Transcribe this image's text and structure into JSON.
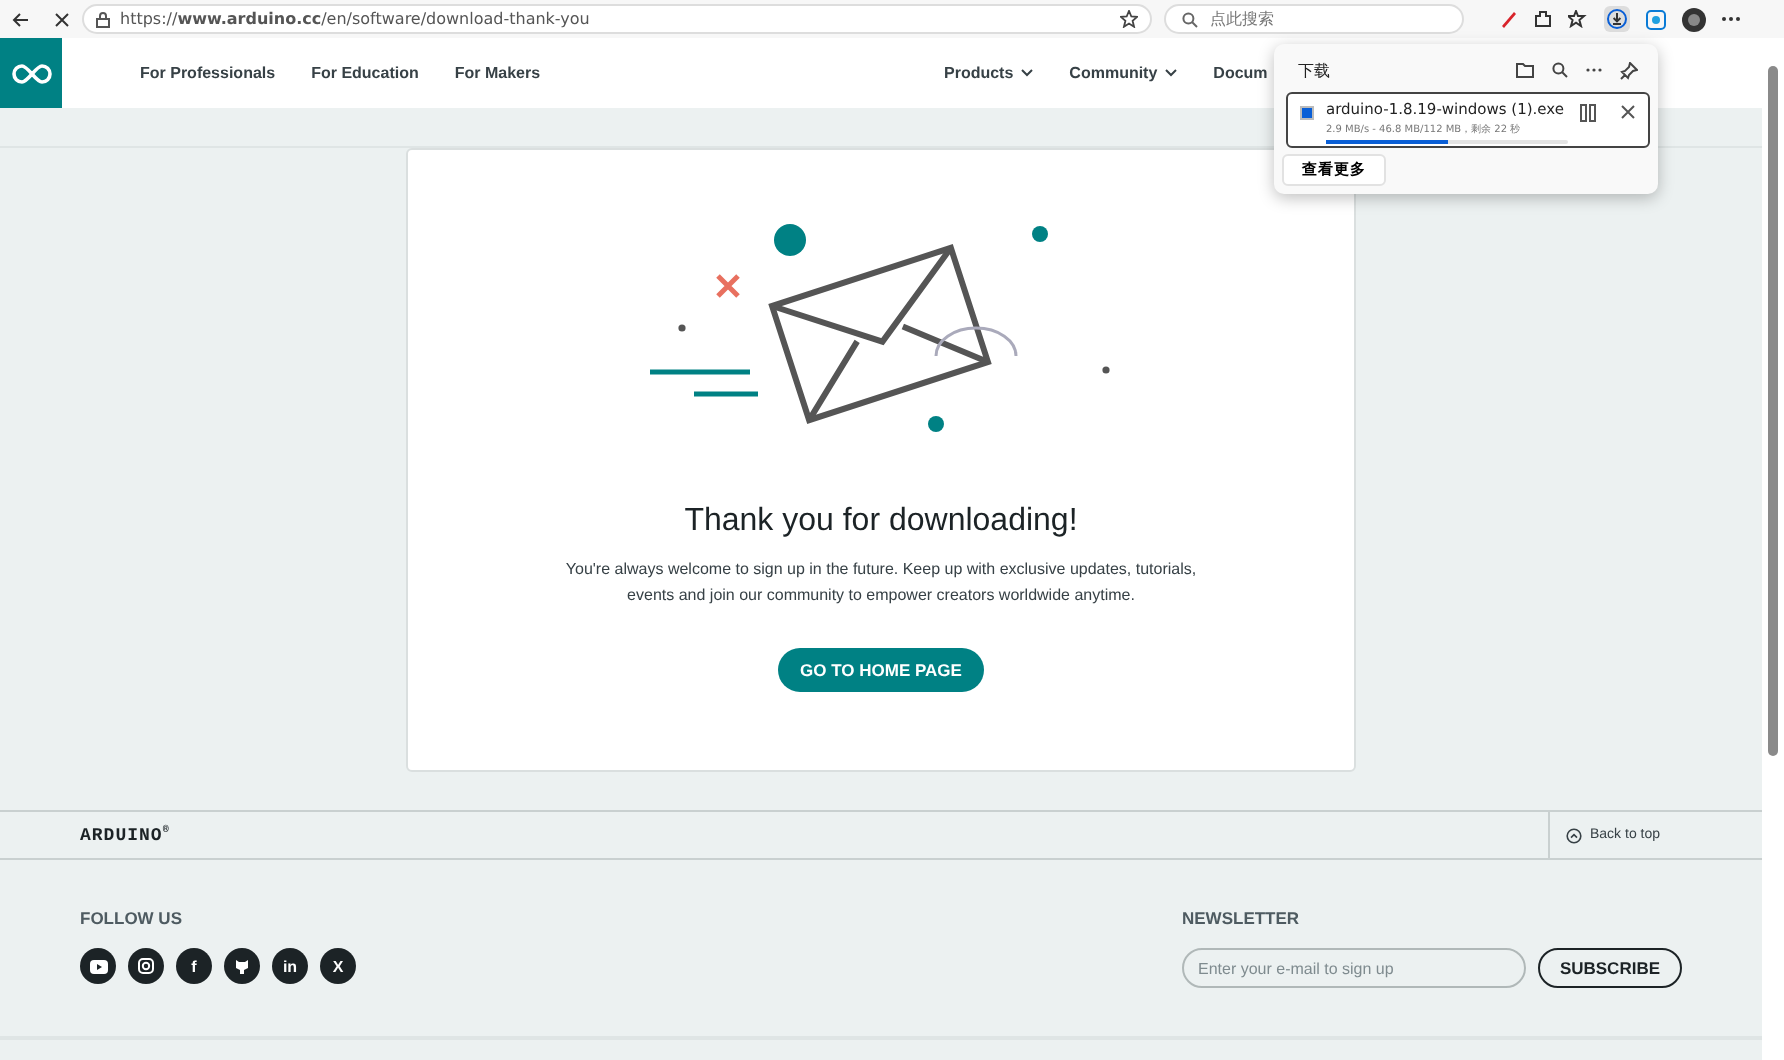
{
  "browser": {
    "address": "https://**www.arduino.cc**/en/software/download-thank-you",
    "search_placeholder": "点此搜索"
  },
  "header": {
    "left_nav": [
      "For Professionals",
      "For Education",
      "For Makers"
    ],
    "right_nav": [
      "Products",
      "Community",
      "Docum"
    ]
  },
  "downloads_panel": {
    "title": "下载",
    "item": {
      "filename": "arduino-1.8.19-windows (1).exe",
      "status": "2.9 MB/s - 46.8 MB/112 MB，剩余 22 秒",
      "level": 0.5
    },
    "more_button": "查看更多"
  },
  "card": {
    "heading": "Thank you for downloading!",
    "message": "You're always welcome to sign up in the future. Keep up with exclusive updates, tutorials, events and join our community to empower creators worldwide anytime.",
    "button": "GO TO HOME PAGE"
  },
  "footer": {
    "brand": "ARDUINO",
    "brand_mark": "®",
    "back_to_top": "Back to top",
    "follow_title": "FOLLOW US",
    "socials": [
      {
        "kind": "video"
      },
      {
        "kind": "camera"
      },
      {
        "kind": "letter",
        "text": "f"
      },
      {
        "kind": "cat"
      },
      {
        "kind": "letter",
        "text": "in"
      },
      {
        "kind": "letter",
        "text": "X"
      }
    ],
    "newsletter_title": "NEWSLETTER",
    "email_placeholder": "Enter your e-mail to sign up",
    "subscribe": "SUBSCRIBE"
  }
}
